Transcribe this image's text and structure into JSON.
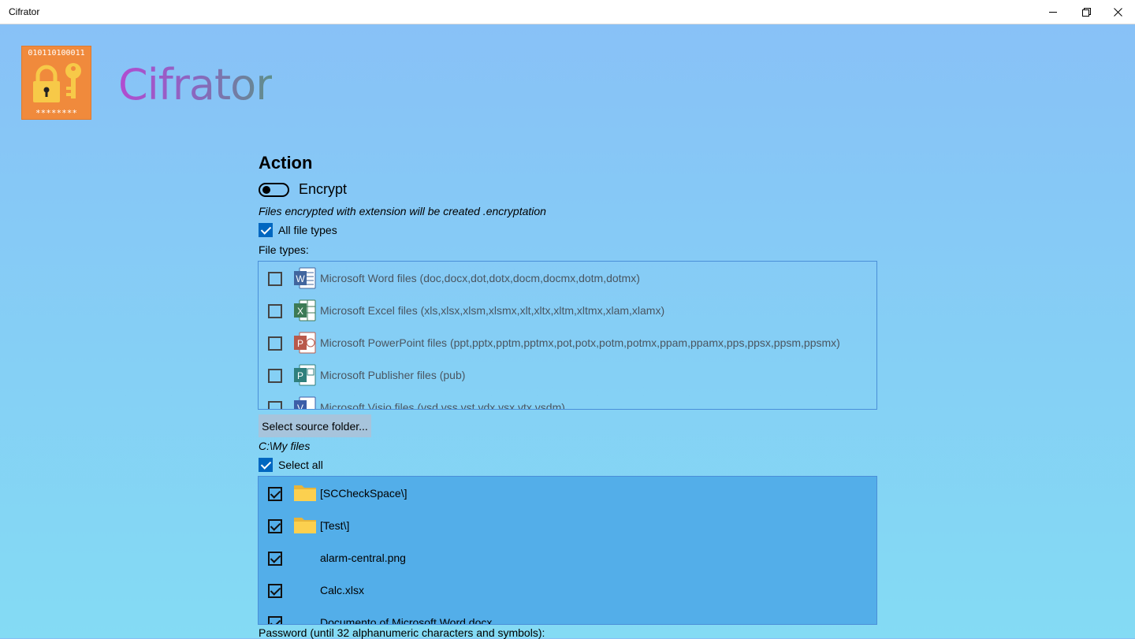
{
  "window": {
    "title": "Cifrator"
  },
  "logo": {
    "bits": "010110100011",
    "stars": "********"
  },
  "brand": "Cifrator",
  "action": {
    "heading": "Action",
    "toggle_label": "Encrypt",
    "toggle_on": false,
    "note": "Files encrypted with extension will be created .encryptation"
  },
  "all_file_types": {
    "label": "All file types",
    "checked": true
  },
  "file_types_label": "File types:",
  "file_types": [
    {
      "label": "Microsoft Word files (doc,docx,dot,dotx,docm,docmx,dotm,dotmx)",
      "icon": "word-icon",
      "checked": false
    },
    {
      "label": "Microsoft Excel files (xls,xlsx,xlsm,xlsmx,xlt,xltx,xltm,xltmx,xlam,xlamx)",
      "icon": "excel-icon",
      "checked": false
    },
    {
      "label": "Microsoft PowerPoint files (ppt,pptx,pptm,pptmx,pot,potx,potm,potmx,ppam,ppamx,pps,ppsx,ppsm,ppsmx)",
      "icon": "powerpoint-icon",
      "checked": false
    },
    {
      "label": "Microsoft Publisher files (pub)",
      "icon": "publisher-icon",
      "checked": false
    },
    {
      "label": "Microsoft Visio files (vsd,vss,vst,vdx,vsx,vtx,vsdm)",
      "icon": "visio-icon",
      "checked": false
    }
  ],
  "select_folder_button": "Select source folder...",
  "source_path": "C:\\My files",
  "select_all": {
    "label": "Select all",
    "checked": true
  },
  "files": [
    {
      "name": "[SCCheckSpace\\]",
      "icon": "folder-icon",
      "checked": true
    },
    {
      "name": "[Test\\]",
      "icon": "folder-icon",
      "checked": true
    },
    {
      "name": "alarm-central.png",
      "icon": "",
      "checked": true
    },
    {
      "name": "Calc.xlsx",
      "icon": "",
      "checked": true
    },
    {
      "name": "Documento of Microsoft Word.docx",
      "icon": "",
      "checked": true
    }
  ],
  "password_label": "Password (until 32 alphanumeric characters and symbols):",
  "colors": {
    "accent": "#0067c0",
    "files_list_bg": "#53aee9",
    "logo_bg": "#f08a3c"
  }
}
